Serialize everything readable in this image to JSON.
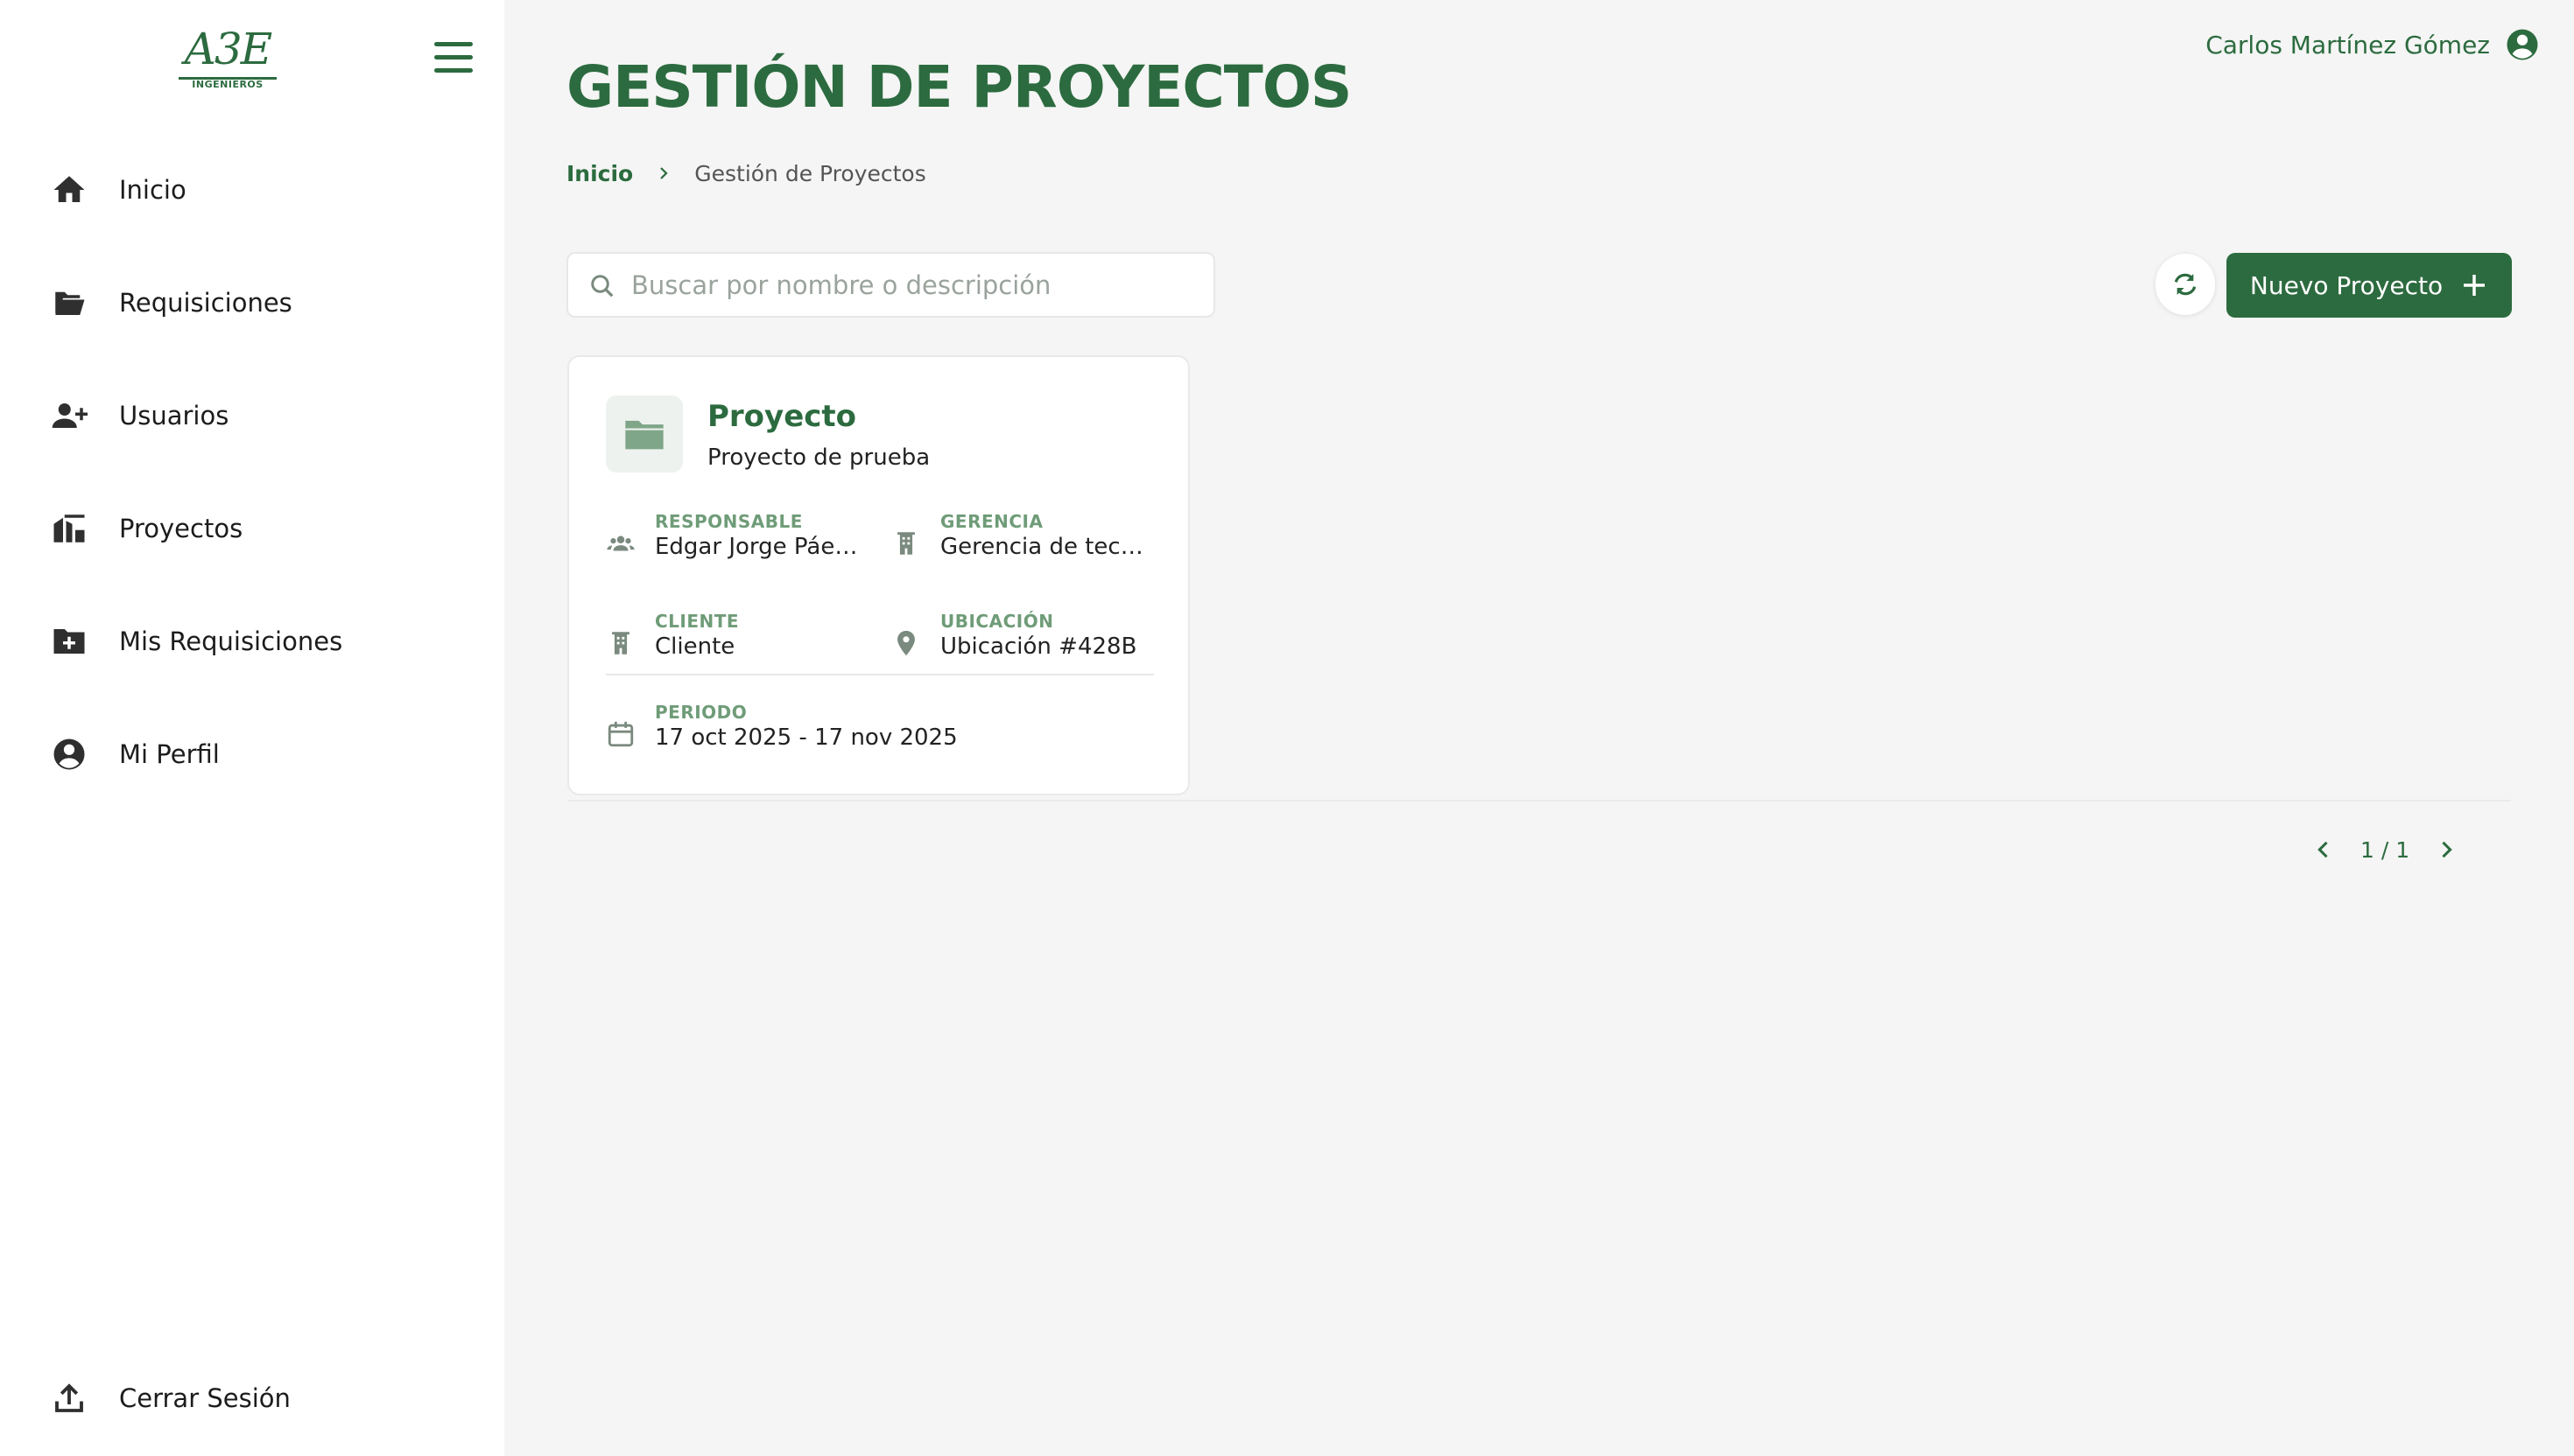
{
  "brand": {
    "logo_text": "A3E",
    "logo_subtitle": "INGENIEROS",
    "accent_color": "#2c6b3f"
  },
  "sidebar": {
    "items": [
      {
        "label": "Inicio",
        "icon": "home-icon"
      },
      {
        "label": "Requisiciones",
        "icon": "folder-open-icon"
      },
      {
        "label": "Usuarios",
        "icon": "user-add-icon"
      },
      {
        "label": "Proyectos",
        "icon": "construction-icon"
      },
      {
        "label": "Mis Requisiciones",
        "icon": "file-plus-icon"
      },
      {
        "label": "Mi Perfil",
        "icon": "user-circle-icon"
      }
    ],
    "logout": {
      "label": "Cerrar Sesión",
      "icon": "upload-icon"
    }
  },
  "header": {
    "title": "GESTIÓN DE PROYECTOS",
    "user_name": "Carlos Martínez Gómez"
  },
  "breadcrumb": {
    "home": "Inicio",
    "current": "Gestión de Proyectos"
  },
  "search": {
    "placeholder": "Buscar por nombre o descripción",
    "value": ""
  },
  "actions": {
    "new_project_label": "Nuevo Proyecto"
  },
  "project_card": {
    "title": "Proyecto",
    "description": "Proyecto de prueba",
    "responsable": {
      "label": "RESPONSABLE",
      "value": "Edgar Jorge Páez ..."
    },
    "gerencia": {
      "label": "GERENCIA",
      "value": "Gerencia de tecnol..."
    },
    "cliente": {
      "label": "CLIENTE",
      "value": "Cliente"
    },
    "ubicacion": {
      "label": "UBICACIÓN",
      "value": "Ubicación #428B"
    },
    "periodo": {
      "label": "PERIODO",
      "value": "17 oct 2025 - 17 nov 2025"
    }
  },
  "pagination": {
    "text": "1 / 1"
  }
}
